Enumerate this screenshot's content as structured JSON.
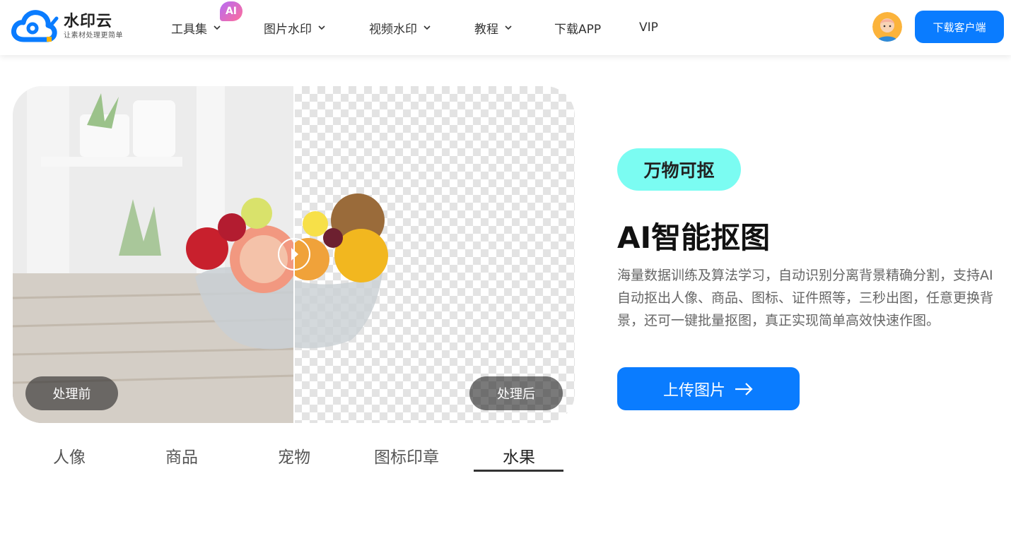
{
  "header": {
    "logo": {
      "name": "水印云",
      "slogan": "让素材处理更简单",
      "icon": "cloud-logo-icon"
    },
    "nav": [
      {
        "label": "工具集",
        "has_dropdown": true
      },
      {
        "label": "图片水印",
        "has_dropdown": true
      },
      {
        "label": "视频水印",
        "has_dropdown": true
      },
      {
        "label": "教程",
        "has_dropdown": true
      },
      {
        "label": "下载APP",
        "has_dropdown": false
      },
      {
        "label": "VIP",
        "has_dropdown": false
      }
    ],
    "ai_badge": "AI",
    "avatar_icon": "user-avatar-icon",
    "download_button": "下载客户端"
  },
  "demo": {
    "before_label": "处理前",
    "after_label": "处理后",
    "handle_icon": "compare-slider-icon"
  },
  "tabs": {
    "items": [
      "人像",
      "商品",
      "宠物",
      "图标印章",
      "水果"
    ],
    "active": "水果"
  },
  "feature": {
    "badge": "万物可抠",
    "title": "AI智能抠图",
    "description": "海量数据训练及算法学习，自动识别分离背景精确分割，支持AI自动抠出人像、商品、图标、证件照等，三秒出图，任意更换背景，还可一键批量抠图，真正实现简单高效快速作图。",
    "upload_button": "上传图片",
    "upload_icon": "arrow-right-icon"
  },
  "colors": {
    "primary": "#0a7cff",
    "badge_bg": "#7bfcf2"
  }
}
